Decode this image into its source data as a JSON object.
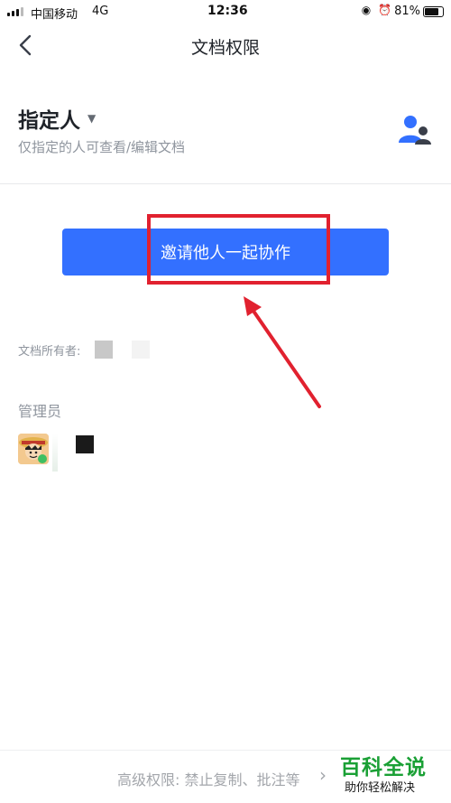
{
  "status_bar": {
    "carrier": "中国移动",
    "network": "4G",
    "time": "12:36",
    "status_icons": "◉ ⏰",
    "battery_percent": "81%",
    "battery_level": 0.81
  },
  "nav": {
    "back_icon": "chevron-left-icon",
    "title": "文档权限"
  },
  "permission": {
    "title": "指定人",
    "caret": "▼",
    "description": "仅指定的人可查看/编辑文档",
    "people_icon": "people-icon"
  },
  "invite_button": {
    "label": "邀请他人一起协作",
    "color": "#3370ff"
  },
  "annotation": {
    "color": "#e1212f"
  },
  "owner": {
    "label": "文档所有者:"
  },
  "admin": {
    "label": "管理员"
  },
  "bottom": {
    "advanced_text": "高级权限: 禁止复制、批注等",
    "chevron": "›"
  },
  "watermark": {
    "title": "百科全说",
    "subtitle": "助你轻松解决",
    "color": "#1aa035"
  }
}
